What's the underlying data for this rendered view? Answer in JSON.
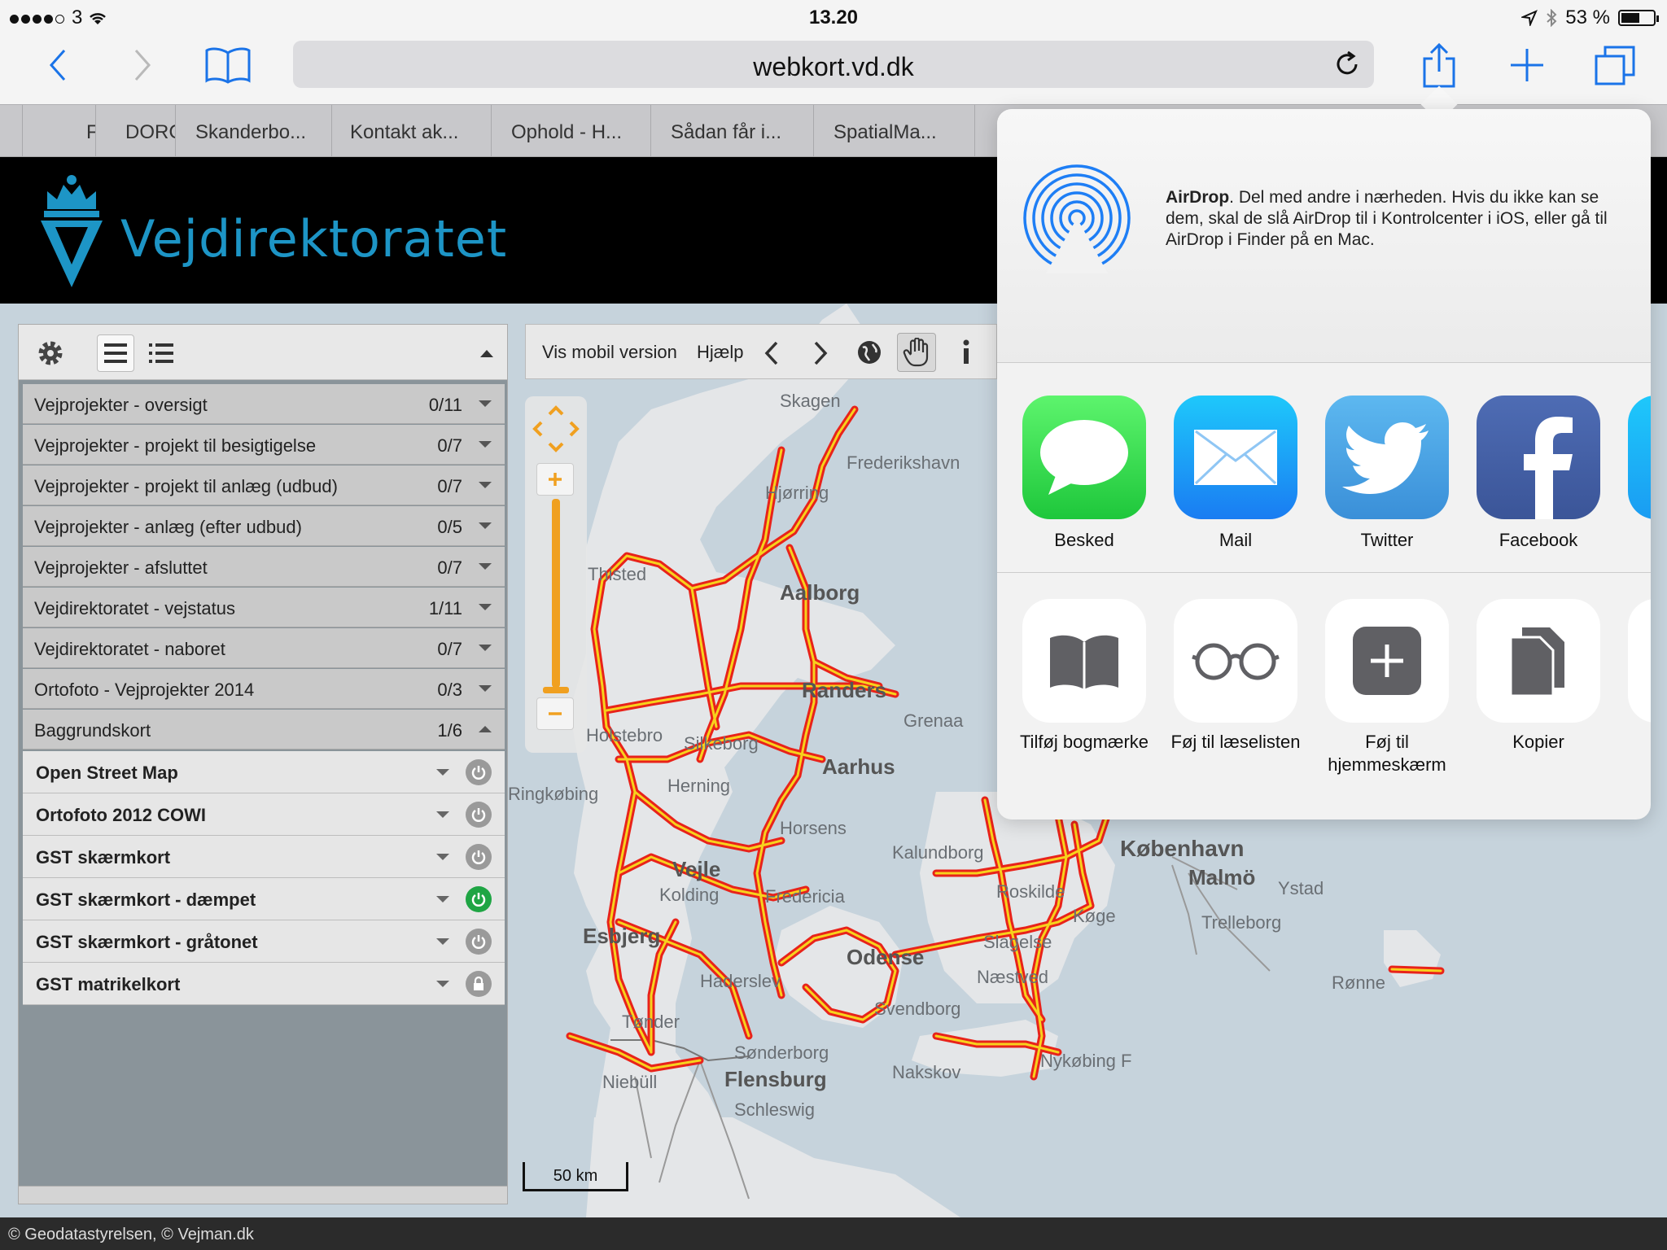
{
  "status_bar": {
    "carrier": "3",
    "time": "13.20",
    "battery_text": "53 %"
  },
  "browser": {
    "url": "webkort.vd.dk",
    "tabs": [
      "F",
      "DORC",
      "Skanderbo...",
      "Kontakt ak...",
      "Ophold - H...",
      "Sådan får i...",
      "SpatialMa..."
    ]
  },
  "site": {
    "logo_text": "Vejdirektoratet"
  },
  "panel": {
    "layers": [
      {
        "label": "Vejprojekter - oversigt",
        "count": "0/11"
      },
      {
        "label": "Vejprojekter - projekt til besigtigelse",
        "count": "0/7"
      },
      {
        "label": "Vejprojekter - projekt til anlæg (udbud)",
        "count": "0/7"
      },
      {
        "label": "Vejprojekter - anlæg (efter udbud)",
        "count": "0/5"
      },
      {
        "label": "Vejprojekter - afsluttet",
        "count": "0/7"
      },
      {
        "label": "Vejdirektoratet - vejstatus",
        "count": "1/11"
      },
      {
        "label": "Vejdirektoratet - naboret",
        "count": "0/7"
      },
      {
        "label": "Ortofoto - Vejprojekter 2014",
        "count": "0/3"
      },
      {
        "label": "Baggrundskort",
        "count": "1/6"
      }
    ],
    "basemaps": [
      {
        "label": "Open Street Map",
        "state": "off"
      },
      {
        "label": "Ortofoto 2012 COWI",
        "state": "off"
      },
      {
        "label": "GST skærmkort",
        "state": "off"
      },
      {
        "label": "GST skærmkort - dæmpet",
        "state": "on"
      },
      {
        "label": "GST skærmkort - gråtonet",
        "state": "off"
      },
      {
        "label": "GST matrikelkort",
        "state": "locked"
      }
    ]
  },
  "map_toolbar": {
    "mobile_label": "Vis mobil version",
    "help_label": "Hjælp"
  },
  "map": {
    "places": [
      "Skagen",
      "Frederikshavn",
      "Hjørring",
      "Thisted",
      "Aalborg",
      "Randers",
      "Grenaa",
      "Holstebro",
      "Silkeborg",
      "Aarhus",
      "Herning",
      "Ringkøbing",
      "Horsens",
      "Vejle",
      "Kolding",
      "Fredericia",
      "Esbjerg",
      "Kalundborg",
      "København",
      "Malmö",
      "Ystad",
      "Roskilde",
      "Køge",
      "Trelleborg",
      "Odense",
      "Slagelse",
      "Næstved",
      "Haderslev",
      "Svendborg",
      "Tønder",
      "Sønderborg",
      "Niebüll",
      "Flensburg",
      "Nakskov",
      "Nykøbing F",
      "Schleswig",
      "Rønne"
    ],
    "scale_label": "50 km",
    "copyright": "© Geodatastyrelsen, © Vejman.dk"
  },
  "share_sheet": {
    "airdrop_title": "AirDrop",
    "airdrop_desc": ". Del med andre i nærheden. Hvis du ikke kan se dem, skal de slå AirDrop til i Kontrolcenter i iOS, eller gå til AirDrop i Finder på en Mac.",
    "apps": [
      "Besked",
      "Mail",
      "Twitter",
      "Facebook"
    ],
    "actions": [
      "Tilføj bogmærke",
      "Føj til læselisten",
      "Føj til hjemmeskærm",
      "Kopier"
    ]
  },
  "colors": {
    "accent_blue": "#1a73e8",
    "logo_blue": "#1d95c6",
    "road_red": "#e8231a",
    "road_yellow": "#f7d21c",
    "power_on": "#1fa544"
  }
}
